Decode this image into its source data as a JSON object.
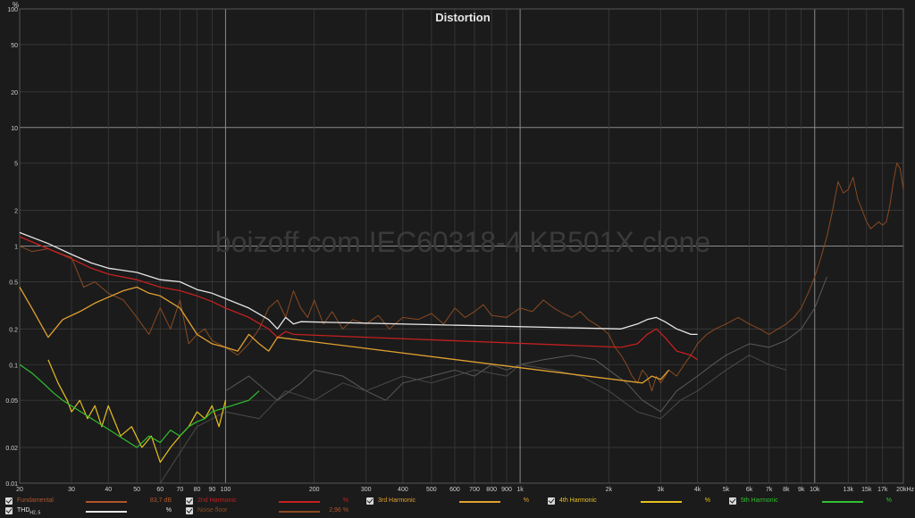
{
  "chart_data": {
    "type": "line",
    "title": "Distortion",
    "watermark": "boizoff.com IEC60318-4 KB501X clone",
    "ylabel": "%",
    "xscale": "log",
    "yscale": "log",
    "xlim": [
      20,
      20000
    ],
    "ylim": [
      0.01,
      100
    ],
    "y_ticks": [
      {
        "v": 100,
        "label": "100"
      },
      {
        "v": 50,
        "label": "50"
      },
      {
        "v": 20,
        "label": "20"
      },
      {
        "v": 10,
        "label": "10"
      },
      {
        "v": 5,
        "label": "5"
      },
      {
        "v": 2,
        "label": "2"
      },
      {
        "v": 1,
        "label": "1"
      },
      {
        "v": 0.5,
        "label": "0.5"
      },
      {
        "v": 0.2,
        "label": "0.2"
      },
      {
        "v": 0.1,
        "label": "0.1"
      },
      {
        "v": 0.05,
        "label": "0.05"
      },
      {
        "v": 0.02,
        "label": "0.02"
      },
      {
        "v": 0.01,
        "label": "0.01"
      }
    ],
    "x_ticks": [
      {
        "v": 20,
        "label": "20"
      },
      {
        "v": 30,
        "label": "30"
      },
      {
        "v": 40,
        "label": "40"
      },
      {
        "v": 50,
        "label": "50"
      },
      {
        "v": 60,
        "label": "60"
      },
      {
        "v": 70,
        "label": "70"
      },
      {
        "v": 80,
        "label": "80"
      },
      {
        "v": 90,
        "label": "90"
      },
      {
        "v": 100,
        "label": "100"
      },
      {
        "v": 200,
        "label": "200"
      },
      {
        "v": 300,
        "label": "300"
      },
      {
        "v": 400,
        "label": "400"
      },
      {
        "v": 500,
        "label": "500"
      },
      {
        "v": 600,
        "label": "600"
      },
      {
        "v": 700,
        "label": "700"
      },
      {
        "v": 800,
        "label": "800"
      },
      {
        "v": 900,
        "label": "900"
      },
      {
        "v": 1000,
        "label": "1k"
      },
      {
        "v": 2000,
        "label": "2k"
      },
      {
        "v": 3000,
        "label": "3k"
      },
      {
        "v": 4000,
        "label": "4k"
      },
      {
        "v": 5000,
        "label": "5k"
      },
      {
        "v": 6000,
        "label": "6k"
      },
      {
        "v": 7000,
        "label": "7k"
      },
      {
        "v": 8000,
        "label": "8k"
      },
      {
        "v": 9000,
        "label": "9k"
      },
      {
        "v": 10000,
        "label": "10k"
      },
      {
        "v": 13000,
        "label": "13k"
      },
      {
        "v": 15000,
        "label": "15k"
      },
      {
        "v": 17000,
        "label": "17k"
      },
      {
        "v": 20000,
        "label": "20kHz"
      }
    ],
    "major_x": [
      100,
      1000,
      10000
    ],
    "major_y": [
      1,
      10
    ],
    "series": [
      {
        "name": "Noise floor",
        "color": "#8a4a22",
        "width": 1.0,
        "x": [
          20,
          22,
          25,
          28,
          30,
          33,
          36,
          40,
          45,
          50,
          55,
          60,
          65,
          70,
          75,
          80,
          85,
          90,
          100,
          110,
          120,
          130,
          140,
          150,
          160,
          170,
          180,
          190,
          200,
          215,
          230,
          250,
          270,
          300,
          330,
          360,
          400,
          450,
          500,
          550,
          600,
          650,
          700,
          750,
          800,
          900,
          1000,
          1100,
          1200,
          1300,
          1400,
          1500,
          1600,
          1700,
          1800,
          1900,
          2000,
          2100,
          2200,
          2300,
          2400,
          2500,
          2600,
          2700,
          2800,
          2900,
          3000,
          3200,
          3400,
          3600,
          3800,
          4000,
          4300,
          4600,
          5000,
          5500,
          6000,
          6500,
          7000,
          7500,
          8000,
          8500,
          9000,
          9500,
          10000,
          10500,
          11000,
          11500,
          12000,
          12500,
          13000,
          13500,
          14000,
          14500,
          15000,
          15500,
          16000,
          16500,
          17000,
          17500,
          18000,
          18500,
          19000,
          19500,
          20000
        ],
        "y": [
          1.0,
          0.9,
          0.95,
          0.85,
          0.8,
          0.45,
          0.5,
          0.4,
          0.35,
          0.25,
          0.18,
          0.3,
          0.2,
          0.35,
          0.15,
          0.18,
          0.2,
          0.16,
          0.14,
          0.12,
          0.15,
          0.2,
          0.3,
          0.35,
          0.25,
          0.42,
          0.3,
          0.25,
          0.35,
          0.22,
          0.28,
          0.2,
          0.24,
          0.22,
          0.26,
          0.2,
          0.25,
          0.24,
          0.27,
          0.22,
          0.3,
          0.25,
          0.28,
          0.32,
          0.26,
          0.25,
          0.3,
          0.28,
          0.35,
          0.3,
          0.27,
          0.25,
          0.28,
          0.24,
          0.22,
          0.2,
          0.18,
          0.14,
          0.12,
          0.1,
          0.08,
          0.07,
          0.09,
          0.08,
          0.06,
          0.08,
          0.07,
          0.09,
          0.08,
          0.1,
          0.12,
          0.15,
          0.18,
          0.2,
          0.22,
          0.25,
          0.22,
          0.2,
          0.18,
          0.2,
          0.22,
          0.25,
          0.3,
          0.4,
          0.55,
          0.8,
          1.2,
          2.0,
          3.5,
          2.8,
          3.0,
          3.8,
          2.5,
          2.0,
          1.6,
          1.4,
          1.5,
          1.6,
          1.5,
          1.6,
          2.2,
          3.5,
          5.0,
          4.5,
          3.0
        ]
      },
      {
        "name": "Fundamental trace grey 1",
        "color": "#5a5a5a",
        "width": 1.0,
        "x": [
          100,
          120,
          150,
          180,
          200,
          250,
          300,
          350,
          400,
          500,
          600,
          700,
          800,
          900,
          1000,
          1200,
          1500,
          1800,
          2000,
          2300,
          2600,
          3000,
          3400,
          4000,
          4500,
          5000,
          6000,
          7000,
          8000,
          9000,
          10000,
          11000
        ],
        "y": [
          0.06,
          0.08,
          0.05,
          0.07,
          0.09,
          0.08,
          0.06,
          0.05,
          0.07,
          0.08,
          0.09,
          0.08,
          0.1,
          0.09,
          0.1,
          0.11,
          0.12,
          0.11,
          0.09,
          0.07,
          0.05,
          0.04,
          0.06,
          0.08,
          0.1,
          0.12,
          0.15,
          0.14,
          0.16,
          0.2,
          0.3,
          0.55
        ]
      },
      {
        "name": "Fundamental trace grey 2",
        "color": "#4a4a4a",
        "width": 1.0,
        "x": [
          60,
          80,
          100,
          130,
          160,
          200,
          250,
          300,
          400,
          500,
          700,
          900,
          1000,
          1300,
          1600,
          2000,
          2500,
          3000,
          3500,
          4000,
          5000,
          6000,
          7000,
          8000
        ],
        "y": [
          0.01,
          0.03,
          0.04,
          0.035,
          0.06,
          0.05,
          0.07,
          0.06,
          0.08,
          0.07,
          0.09,
          0.08,
          0.1,
          0.09,
          0.08,
          0.06,
          0.04,
          0.035,
          0.05,
          0.06,
          0.09,
          0.12,
          0.1,
          0.09
        ]
      },
      {
        "name": "THD",
        "color": "#e6e6e6",
        "width": 1.3,
        "x": [
          20,
          25,
          30,
          35,
          40,
          50,
          60,
          70,
          80,
          90,
          100,
          120,
          140,
          150,
          160,
          170,
          180,
          2200,
          2500,
          2700,
          2900,
          3100,
          3400,
          3800,
          4000
        ],
        "y": [
          1.3,
          1.05,
          0.85,
          0.72,
          0.65,
          0.6,
          0.52,
          0.5,
          0.43,
          0.4,
          0.36,
          0.3,
          0.24,
          0.2,
          0.25,
          0.22,
          0.23,
          0.2,
          0.22,
          0.24,
          0.25,
          0.23,
          0.2,
          0.18,
          0.18
        ]
      },
      {
        "name": "2nd Harmonic",
        "color": "#c42020",
        "width": 1.3,
        "x": [
          20,
          25,
          30,
          35,
          40,
          50,
          60,
          70,
          80,
          90,
          100,
          120,
          140,
          150,
          160,
          170,
          2200,
          2500,
          2700,
          2900,
          3100,
          3400,
          3800,
          4000
        ],
        "y": [
          1.2,
          0.95,
          0.78,
          0.65,
          0.58,
          0.52,
          0.45,
          0.42,
          0.38,
          0.34,
          0.3,
          0.25,
          0.2,
          0.17,
          0.19,
          0.18,
          0.14,
          0.15,
          0.18,
          0.2,
          0.17,
          0.13,
          0.12,
          0.11
        ]
      },
      {
        "name": "3rd Harmonic",
        "color": "#e0a030",
        "width": 1.3,
        "x": [
          20,
          22,
          25,
          28,
          32,
          36,
          40,
          45,
          50,
          55,
          60,
          70,
          80,
          90,
          100,
          110,
          120,
          130,
          140,
          150,
          2600,
          2800,
          3000,
          3200
        ],
        "y": [
          0.45,
          0.3,
          0.17,
          0.24,
          0.28,
          0.33,
          0.37,
          0.42,
          0.45,
          0.4,
          0.38,
          0.3,
          0.18,
          0.15,
          0.14,
          0.13,
          0.18,
          0.15,
          0.13,
          0.17,
          0.07,
          0.08,
          0.075,
          0.09
        ]
      },
      {
        "name": "4th Harmonic",
        "color": "#e8c020",
        "width": 1.2,
        "x": [
          25,
          27,
          29,
          30,
          32,
          34,
          36,
          38,
          40,
          44,
          48,
          52,
          56,
          60,
          65,
          70,
          75,
          80,
          85,
          90,
          95,
          100
        ],
        "y": [
          0.11,
          0.07,
          0.05,
          0.04,
          0.05,
          0.035,
          0.045,
          0.03,
          0.045,
          0.025,
          0.03,
          0.02,
          0.025,
          0.015,
          0.02,
          0.025,
          0.03,
          0.04,
          0.035,
          0.045,
          0.03,
          0.05
        ]
      },
      {
        "name": "5th Harmonic",
        "color": "#30c030",
        "width": 1.2,
        "x": [
          20,
          22,
          24,
          26,
          28,
          50,
          55,
          60,
          65,
          70,
          75,
          80,
          85,
          90,
          120,
          125,
          130
        ],
        "y": [
          0.1,
          0.085,
          0.07,
          0.058,
          0.05,
          0.02,
          0.025,
          0.022,
          0.028,
          0.025,
          0.03,
          0.033,
          0.035,
          0.04,
          0.05,
          0.055,
          0.06
        ]
      }
    ]
  },
  "legend": {
    "fundamental": {
      "label": "Fundamental",
      "value": "83,7 dB",
      "color": "#b0552a"
    },
    "thd": {
      "label": "THD",
      "sub": "H2..5",
      "value": "%",
      "color": "#e6e6e6"
    },
    "h2": {
      "label": "2nd Harmonic",
      "value": "%",
      "color": "#c42020"
    },
    "noise": {
      "label": "Noise floor",
      "value": "2,96 %",
      "color": "#8a4a22"
    },
    "h3": {
      "label": "3rd Harmonic",
      "value": "%",
      "color": "#e0a030"
    },
    "h4": {
      "label": "4th Harmonic",
      "value": "%",
      "color": "#e8c020"
    },
    "h5": {
      "label": "5th Harmonic",
      "value": "%",
      "color": "#30c030"
    }
  }
}
